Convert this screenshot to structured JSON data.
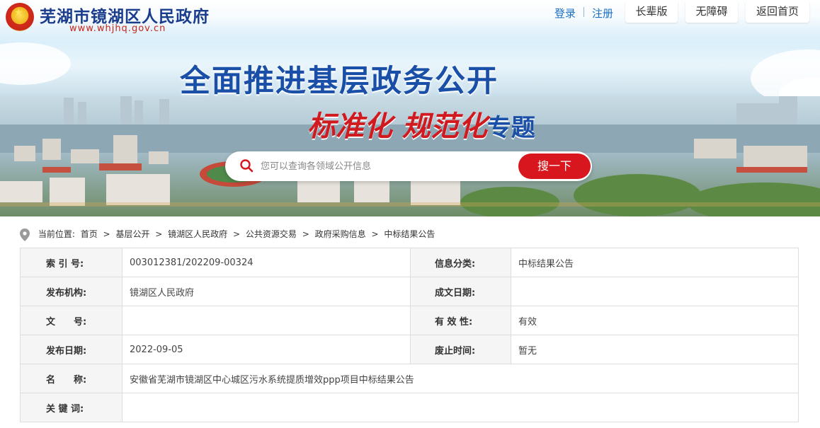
{
  "site": {
    "name": "芜湖市镜湖区人民政府",
    "url": "www.whjhq.gov.cn"
  },
  "top_nav": {
    "login": "登录",
    "register": "注册",
    "elder_mode": "长辈版",
    "accessibility": "无障碍",
    "home": "返回首页"
  },
  "banner": {
    "headline": "全面推进基层政务公开",
    "subline_red": "标准化 规范化",
    "subline_blue": "专题"
  },
  "search": {
    "placeholder": "您可以查询各领域公开信息",
    "button": "搜一下"
  },
  "breadcrumb": {
    "label": "当前位置:",
    "items": [
      "首页",
      "基层公开",
      "镜湖区人民政府",
      "公共资源交易",
      "政府采购信息",
      "中标结果公告"
    ],
    "separator": ">"
  },
  "info": {
    "index_label": "索 引 号:",
    "index_value": "003012381/202209-00324",
    "category_label": "信息分类:",
    "category_value": "中标结果公告",
    "publisher_label": "发布机构:",
    "publisher_value": "镜湖区人民政府",
    "created_label": "成文日期:",
    "created_value": "",
    "docno_label": "文　　号:",
    "docno_value": "",
    "validity_label": "有 效 性:",
    "validity_value": "有效",
    "pubdate_label": "发布日期:",
    "pubdate_value": "2022-09-05",
    "abolish_label": "废止时间:",
    "abolish_value": "暂无",
    "title_label": "名　　称:",
    "title_value": "安徽省芜湖市镜湖区中心城区污水系统提质增效ppp项目中标结果公告",
    "keywords_label": "关 键 词:",
    "keywords_value": ""
  },
  "colors": {
    "brand_blue": "#1a4fa8",
    "brand_red": "#d7161d",
    "link_blue": "#1a6fc4"
  }
}
